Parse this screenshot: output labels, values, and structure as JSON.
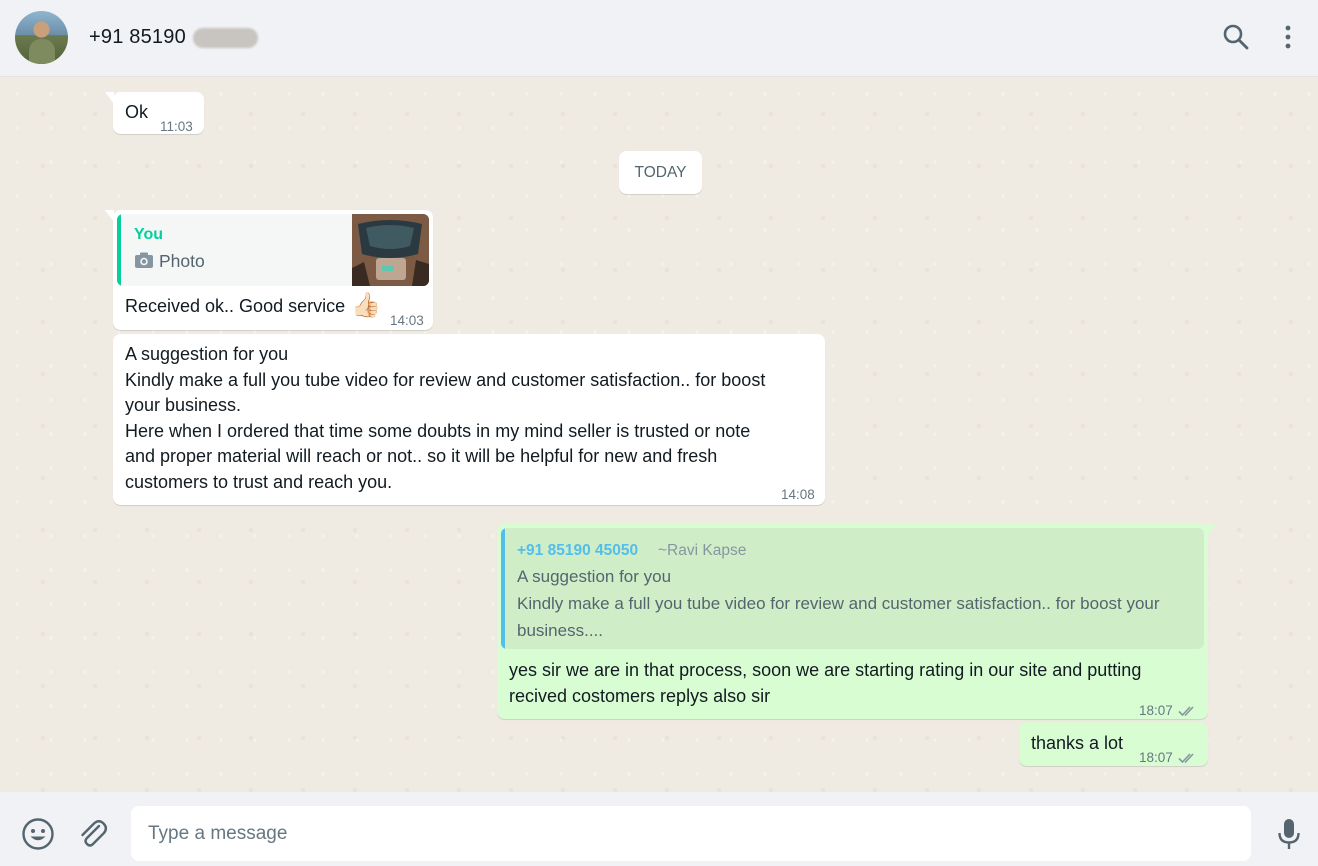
{
  "header": {
    "contact_name": "+91 85190",
    "icons": {
      "search": "search-icon",
      "menu": "more-vertical-icon",
      "avatar": "contact-avatar"
    }
  },
  "messages": {
    "m1": {
      "text": "Ok",
      "time": "11:03"
    },
    "date_separator": "TODAY",
    "m2": {
      "quote_author": "You",
      "quote_text": "Photo",
      "text": "Received ok.. Good service",
      "emoji": "👍🏻",
      "time": "14:03"
    },
    "m3": {
      "lines": [
        "A suggestion for you",
        "Kindly make a full you tube video for review and customer satisfaction.. for boost",
        "your business.",
        "Here when I ordered that time some doubts in my mind seller is trusted or note",
        "and proper material will reach or not.. so it will be helpful for new and fresh",
        "customers to trust and reach you."
      ],
      "time": "14:08"
    },
    "m4": {
      "quote_phone": "+91 85190 45050",
      "quote_name": "~Ravi Kapse",
      "quote_lines": [
        "A suggestion for you",
        "Kindly make a full you tube video for review and customer satisfaction.. for boost your",
        "business...."
      ],
      "lines": [
        "yes sir we are in that process, soon we are starting rating in our site and putting",
        "recived costomers replys also sir"
      ],
      "time": "18:07",
      "status": "read"
    },
    "m5": {
      "text": "thanks a lot",
      "time": "18:07",
      "status": "read"
    }
  },
  "composer": {
    "placeholder": "Type a message",
    "value": "",
    "icons": {
      "emoji": "emoji-icon",
      "attach": "paperclip-icon",
      "voice": "microphone-icon"
    }
  },
  "colors": {
    "header_bg": "#f0f2f5",
    "chat_bg": "#efeae2",
    "incoming_bubble": "#ffffff",
    "outgoing_bubble": "#d9fdd3",
    "quote_accent_you": "#06cf9c",
    "quote_accent_other": "#53bdeb",
    "ticks": "#8696a0"
  }
}
